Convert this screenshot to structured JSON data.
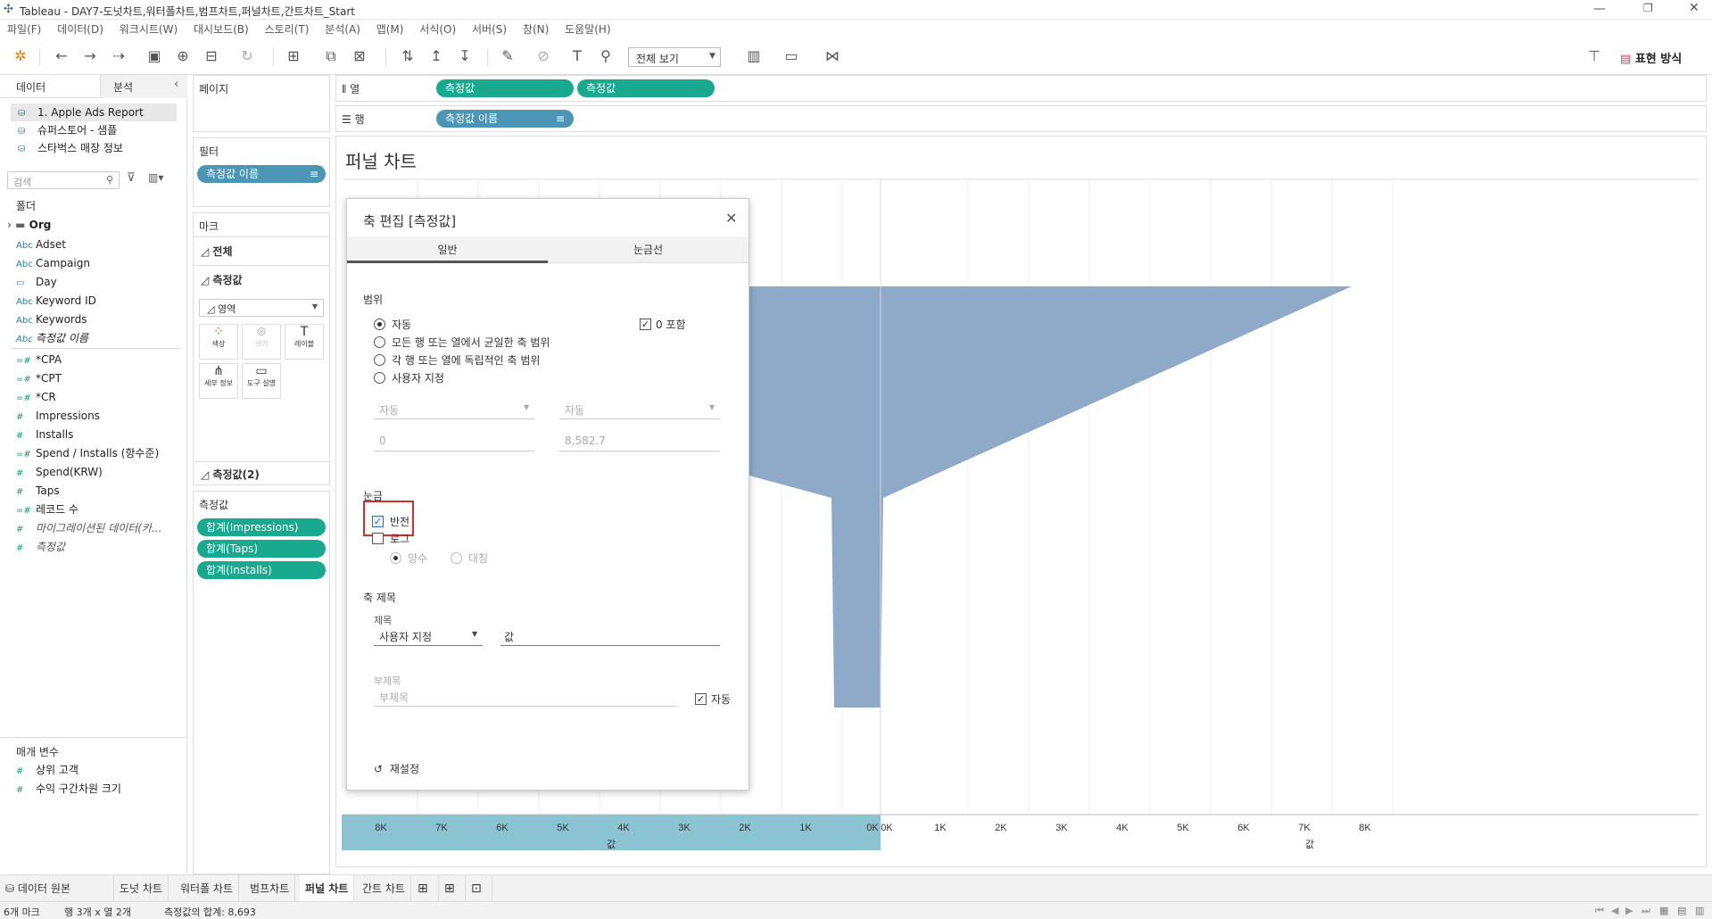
{
  "window": {
    "title": "Tableau - DAY7-도넛차트,워터폴차트,범프차트,퍼널차트,간트차트_Start"
  },
  "menu": [
    "파일(F)",
    "데이터(D)",
    "워크시트(W)",
    "대시보드(B)",
    "스토리(T)",
    "분석(A)",
    "맵(M)",
    "서식(O)",
    "서버(S)",
    "창(N)",
    "도움말(H)"
  ],
  "toolbar": {
    "view_dropdown": "전체 보기",
    "show_me": "표현 방식"
  },
  "datapane": {
    "tab_data": "데이터",
    "tab_analysis": "분석",
    "sources": [
      "1. Apple Ads Report",
      "슈퍼스토어 - 샘플",
      "스타벅스 매장 정보"
    ],
    "search_placeholder": "검색",
    "folders_label": "폴더",
    "folder_org": "Org",
    "dimensions": [
      "Adset",
      "Campaign",
      "Day",
      "Keyword ID",
      "Keywords",
      "측정값 이름"
    ],
    "measures": [
      "*CPA",
      "*CPT",
      "*CR",
      "Impressions",
      "Installs",
      "Spend / Installs (항수준)",
      "Spend(KRW)",
      "Taps",
      "레코드 수",
      "마이그레이션된 데이터(카...",
      "측정값"
    ],
    "params_label": "매개 변수",
    "params": [
      "상위 고객",
      "수익 구간차원 크기"
    ]
  },
  "shelves": {
    "pages": "페이지",
    "filters": "필터",
    "filter_pill": "측정값 이름",
    "marks": "마크",
    "marks_all": "전체",
    "marks_measure": "측정값",
    "mark_type": "영역",
    "btn_color": "색상",
    "btn_size": "크기",
    "btn_label": "레이블",
    "btn_detail": "세부 정보",
    "btn_tooltip": "도구 설명",
    "marks_measure2": "측정값(2)",
    "measure_values": "측정값",
    "mv_pills": [
      "합계(Impressions)",
      "합계(Taps)",
      "합계(Installs)"
    ]
  },
  "columns": {
    "label": "열",
    "pills": [
      "측정값",
      "측정값"
    ]
  },
  "rows": {
    "label": "행",
    "pills": [
      "측정값 이름"
    ]
  },
  "view": {
    "title": "퍼널 차트",
    "axis_left_ticks": [
      "8K",
      "7K",
      "6K",
      "5K",
      "4K",
      "3K",
      "2K",
      "1K",
      "0K"
    ],
    "axis_right_ticks": [
      "0K",
      "1K",
      "2K",
      "3K",
      "4K",
      "5K",
      "6K",
      "7K",
      "8K"
    ],
    "axis_title": "값"
  },
  "dialog": {
    "title": "축 편집 [측정값]",
    "tab_general": "일반",
    "tab_ticks": "눈금선",
    "range_label": "범위",
    "range_options": [
      "자동",
      "모든 행 또는 열에서 균일한 축 범위",
      "각 행 또는 열에 독립적인 축 범위",
      "사용자 지정"
    ],
    "include_zero": "0 포함",
    "dd_left": "자동",
    "dd_right": "자동",
    "val_left": "0",
    "val_right": "8,582.7",
    "scale_label": "눈금",
    "reversed": "반전",
    "log": "로그",
    "positive": "양수",
    "symmetric": "대칭",
    "axis_title_label": "축 제목",
    "title_label": "제목",
    "title_mode": "사용자 지정",
    "title_value": "값",
    "subtitle_label": "부제목",
    "subtitle_placeholder": "부제목",
    "subtitle_auto": "자동",
    "reset": "재설정"
  },
  "sheet_tabs": [
    "데이터 원본",
    "도넛 차트",
    "워터폴 차트",
    "범프차트",
    "퍼널 차트",
    "간트 차트"
  ],
  "status": {
    "marks": "6개 마크",
    "rows_cols": "행 3개 x 열 2개",
    "sum": "측정값의 합계: 8,693"
  },
  "colors": {
    "funnel": "#8eaac8",
    "teal_pill": "#19a98f",
    "blue_pill": "#4c95b5",
    "axis_band": "#8cc3d3",
    "highlight": "#d32f2f"
  }
}
